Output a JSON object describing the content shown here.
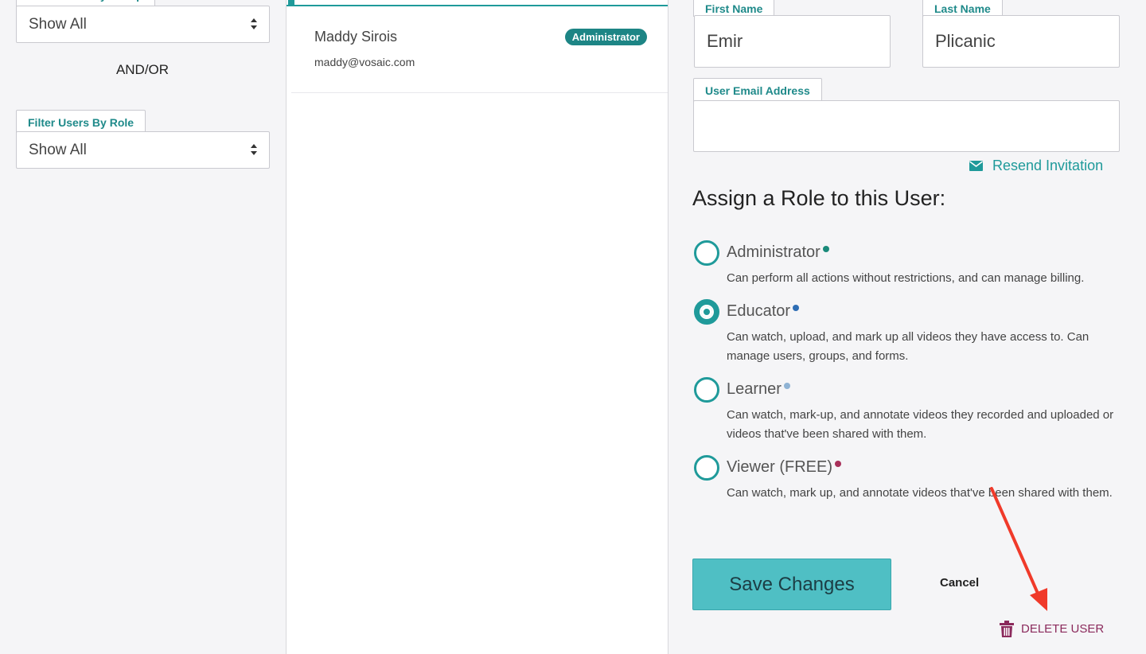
{
  "filters": {
    "group_filter": {
      "label": "Filter Users By Group",
      "value": "Show All"
    },
    "andor": "AND/OR",
    "role_filter": {
      "label": "Filter Users By Role",
      "value": "Show All"
    }
  },
  "user_list": [
    {
      "name": "Maddy Sirois",
      "email": "maddy@vosaic.com",
      "role_badge": "Administrator"
    }
  ],
  "form": {
    "first_name": {
      "label": "First Name",
      "value": "Emir"
    },
    "last_name": {
      "label": "Last Name",
      "value": "Plicanic"
    },
    "email": {
      "label": "User Email Address",
      "value": ""
    },
    "resend_invitation": "Resend Invitation",
    "assign_title": "Assign a Role to this User:",
    "roles": [
      {
        "name": "Administrator",
        "description": "Can perform all actions without restrictions, and can manage billing.",
        "dot_color": "#1a8a7a",
        "selected": false
      },
      {
        "name": "Educator",
        "description": "Can watch, upload, and mark up all videos they have access to. Can manage users, groups, and forms.",
        "dot_color": "#2e6db4",
        "selected": true
      },
      {
        "name": "Learner",
        "description": "Can watch, mark-up, and annotate videos they recorded and uploaded or videos that've been shared with them.",
        "dot_color": "#8fb3d4",
        "selected": false
      },
      {
        "name": "Viewer (FREE)",
        "description": "Can watch, mark up, and annotate videos that've been shared with them.",
        "dot_color": "#a8305a",
        "selected": false
      }
    ],
    "save_label": "Save Changes",
    "cancel_label": "Cancel",
    "delete_label": "DELETE USER"
  },
  "colors": {
    "accent": "#1f9a9a",
    "save_button": "#4fbfc4",
    "delete": "#8b2a5c",
    "annotation_arrow": "#f03a2a"
  }
}
